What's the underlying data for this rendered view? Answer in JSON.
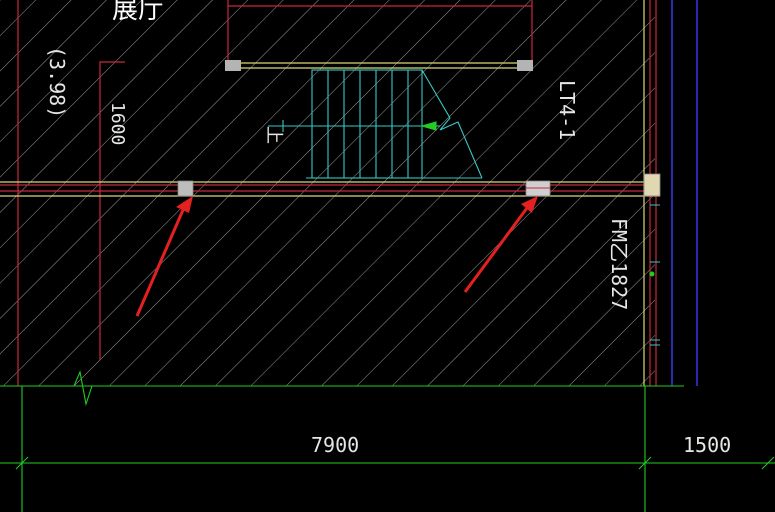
{
  "drawing": {
    "labels": {
      "top_clipped_label": "展厅",
      "elevation_label": "(3.98)",
      "dimension_1600": "1600",
      "stair_label": "LT4-1",
      "stair_arrow_label": "上",
      "door_label": "FM乙1827",
      "dimension_7900": "7900",
      "dimension_1500": "1500"
    },
    "colors": {
      "background": "#000000",
      "hatch": "#9a9a9a",
      "wall_red": "#c8283c",
      "beam_yellow": "#d8d87a",
      "stair_cyan": "#37c8c8",
      "dimension_green": "#22cc22",
      "axis_blue": "#3a3aff",
      "annotation_arrow": "#e62020",
      "column_gray": "#b4b4b4"
    },
    "annotations": [
      {
        "name": "red-pointer-arrow-left"
      },
      {
        "name": "red-pointer-arrow-right"
      }
    ]
  }
}
